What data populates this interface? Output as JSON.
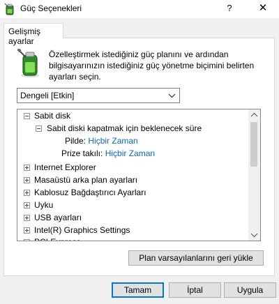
{
  "window": {
    "title": "Güç Seçenekleri",
    "help_glyph": "?",
    "close_glyph": "✕"
  },
  "tab": {
    "label": "Gelişmiş ayarlar"
  },
  "description": "Özelleştirmek istediğiniz güç planını ve ardından bilgisayarınızın istediğiniz güç yönetme biçimini belirten ayarları seçin.",
  "plan_select": {
    "selected": "Dengeli [Etkin]"
  },
  "tree": {
    "items": [
      {
        "label": "Sabit disk"
      },
      {
        "label": "Sabit diski kapatmak için beklenecek süre"
      },
      {
        "label": "Pilde:",
        "value": "Hiçbir Zaman"
      },
      {
        "label": "Prize takılı:",
        "value": "Hiçbir Zaman"
      },
      {
        "label": "Internet Explorer"
      },
      {
        "label": "Masaüstü arka plan ayarları"
      },
      {
        "label": "Kablosuz Bağdaştırıcı Ayarları"
      },
      {
        "label": "Uyku"
      },
      {
        "label": "USB ayarları"
      },
      {
        "label": "Intel(R) Graphics Settings"
      },
      {
        "label": "PCI Express"
      }
    ]
  },
  "buttons": {
    "restore_defaults": "Plan varsayılanlarını geri yükle",
    "ok": "Tamam",
    "cancel": "İptal",
    "apply": "Uygula"
  },
  "colors": {
    "link": "#0a64d2",
    "default_button_border": "#0078d7"
  },
  "icons": {
    "title": "battery-plug-icon",
    "panel": "battery-plug-icon",
    "dropdown": "chevron-down-icon"
  }
}
